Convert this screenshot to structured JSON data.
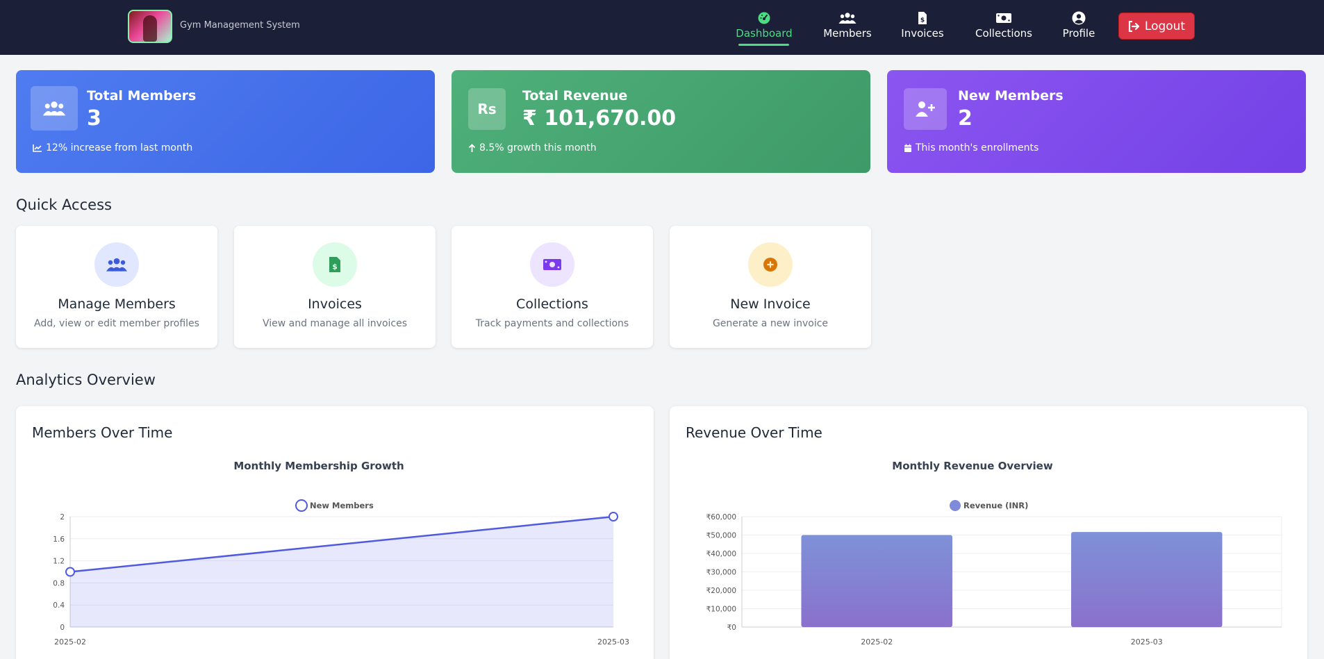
{
  "brand": {
    "name": "Gym Management System"
  },
  "nav": {
    "items": [
      {
        "label": "Dashboard",
        "icon": "dashboard-icon",
        "active": true
      },
      {
        "label": "Members",
        "icon": "users-icon"
      },
      {
        "label": "Invoices",
        "icon": "invoice-icon"
      },
      {
        "label": "Collections",
        "icon": "money-icon"
      },
      {
        "label": "Profile",
        "icon": "user-circle-icon"
      }
    ],
    "logout": "Logout"
  },
  "stats": [
    {
      "label": "Total Members",
      "value": "3",
      "foot": "12% increase from last month",
      "icon": "users-icon",
      "foot_icon": "chart-line-icon",
      "color": "#4670ec"
    },
    {
      "label": "Total Revenue",
      "value": "₹ 101,670.00",
      "foot": "8.5% growth this month",
      "icon": "rupee-icon",
      "foot_icon": "arrow-up-icon",
      "color": "#47a671"
    },
    {
      "label": "New Members",
      "value": "2",
      "foot": "This month's enrollments",
      "icon": "user-plus-icon",
      "foot_icon": "calendar-icon",
      "color": "#7f4bec"
    }
  ],
  "sections": {
    "quick_access": "Quick Access",
    "analytics": "Analytics Overview"
  },
  "quick_access": [
    {
      "title": "Manage Members",
      "desc": "Add, view or edit member profiles",
      "icon": "users-icon",
      "bg": "#e0e7ff",
      "fg": "#3b5bdb"
    },
    {
      "title": "Invoices",
      "desc": "View and manage all invoices",
      "icon": "file-invoice-dollar-icon",
      "bg": "#dcfce7",
      "fg": "#2f9e5a"
    },
    {
      "title": "Collections",
      "desc": "Track payments and collections",
      "icon": "money-bill-icon",
      "bg": "#ede4ff",
      "fg": "#7c3aed"
    },
    {
      "title": "New Invoice",
      "desc": "Generate a new invoice",
      "icon": "plus-circle-icon",
      "bg": "#fdf0c8",
      "fg": "#d97706"
    }
  ],
  "charts": {
    "members_card_title": "Members Over Time",
    "revenue_card_title": "Revenue Over Time"
  },
  "chart_data": [
    {
      "type": "area",
      "title": "Monthly Membership Growth",
      "categories": [
        "2025-02",
        "2025-03"
      ],
      "series": [
        {
          "name": "New Members",
          "values": [
            1,
            2
          ]
        }
      ],
      "ylim": [
        0,
        2
      ],
      "yticks": [
        "0",
        "0.4",
        "0.8",
        "1.2",
        "1.6",
        "2"
      ],
      "legend": "top",
      "grid": true,
      "color": "#4f5ae0"
    },
    {
      "type": "bar",
      "title": "Monthly Revenue Overview",
      "categories": [
        "2025-02",
        "2025-03"
      ],
      "series": [
        {
          "name": "Revenue (INR)",
          "values": [
            50000,
            51670
          ]
        }
      ],
      "ylim": [
        0,
        60000
      ],
      "yticks": [
        "₹0",
        "₹10,000",
        "₹20,000",
        "₹30,000",
        "₹40,000",
        "₹50,000",
        "₹60,000"
      ],
      "legend": "top",
      "grid": true,
      "color": "#7f8bd9"
    }
  ]
}
